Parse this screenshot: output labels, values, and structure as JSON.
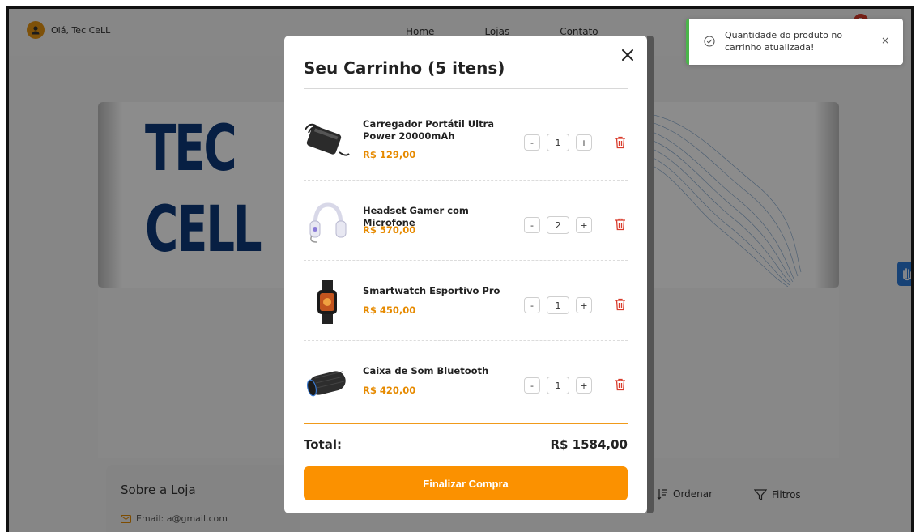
{
  "navbar": {
    "greeting": "Olá, Tec CeLL",
    "links": [
      "Home",
      "Lojas",
      "Contato"
    ],
    "cart_count": "5"
  },
  "banner": {
    "logo_line1": "TEC",
    "logo_line2": "CELL"
  },
  "about": {
    "title": "Sobre a Loja",
    "email": "Email: a@gmail.com"
  },
  "toolbar": {
    "sort_label": "Ordenar",
    "filter_label": "Filtros"
  },
  "cart": {
    "title": "Seu Carrinho (5 itens)",
    "items": [
      {
        "name": "Carregador Portátil Ultra Power 20000mAh",
        "price": "R$ 129,00",
        "qty": "1",
        "icon": "power-bank-image"
      },
      {
        "name": "Headset Gamer com Microfone",
        "price": "R$ 570,00",
        "qty": "2",
        "icon": "headset-image"
      },
      {
        "name": "Smartwatch Esportivo Pro",
        "price": "R$ 450,00",
        "qty": "1",
        "icon": "smartwatch-image"
      },
      {
        "name": "Caixa de Som Bluetooth",
        "price": "R$ 420,00",
        "qty": "1",
        "icon": "speaker-image"
      }
    ],
    "minus_label": "-",
    "plus_label": "+",
    "total_label": "Total:",
    "total_value": "R$ 1584,00",
    "checkout_label": "Finalizar Compra"
  },
  "toast": {
    "message": "Quantidade do produto no carrinho atualizada!",
    "close": "×"
  },
  "colors": {
    "accent": "#fb9100",
    "logo": "#0d3a7a",
    "toast_border": "#4bb44b",
    "delete": "#d93b2b"
  }
}
